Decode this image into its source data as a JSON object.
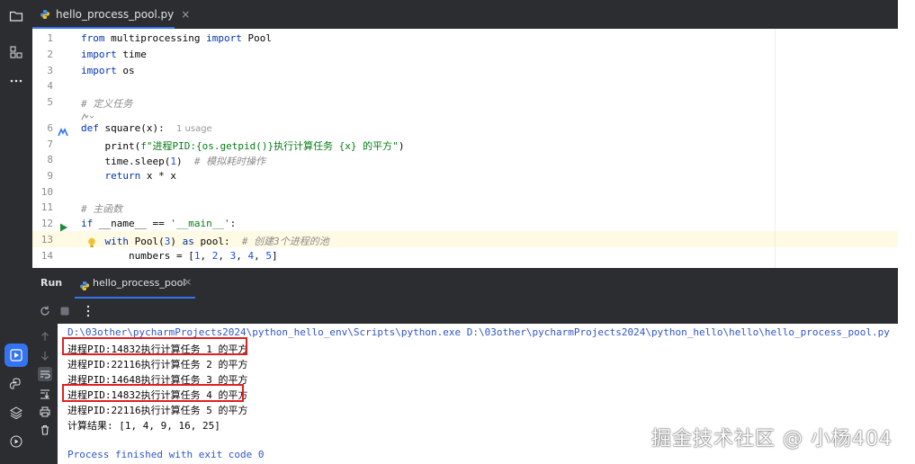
{
  "sidebar": {
    "icons": [
      "folder-icon",
      "structure-icon",
      "more-icon",
      "run-icon",
      "python-console-icon",
      "layers-icon",
      "services-icon"
    ]
  },
  "editor_tab": {
    "label": "hello_process_pool.py",
    "close": "×"
  },
  "editor": {
    "lines": [
      {
        "num": "1"
      },
      {
        "num": "2"
      },
      {
        "num": "3"
      },
      {
        "num": "4"
      },
      {
        "num": "5"
      },
      {
        "num": "6"
      },
      {
        "num": "7"
      },
      {
        "num": "8"
      },
      {
        "num": "9"
      },
      {
        "num": "10"
      },
      {
        "num": "11"
      },
      {
        "num": "12"
      },
      {
        "num": "13"
      },
      {
        "num": "14"
      }
    ],
    "code": {
      "l1_kw1": "from",
      "l1_mod": " multiprocessing ",
      "l1_kw2": "import",
      "l1_name": " Pool",
      "l2_kw": "import",
      "l2_name": " time",
      "l3_kw": "import",
      "l3_name": " os",
      "l5_comment": "# 定义任务",
      "l6_kw": "def",
      "l6_sig": " square(x):",
      "l6_hint": "1 usage",
      "l7_a": "    print(",
      "l7_str": "f\"进程PID:{os.getpid()}执行计算任务 {x} 的平方\"",
      "l7_b": ")",
      "l8_a": "    time.sleep(",
      "l8_num": "1",
      "l8_b": ")  ",
      "l8_comment": "# 模拟耗时操作",
      "l9_kw": "    return",
      "l9_rest": " x * x",
      "l11_comment": "# 主函数",
      "l12_kw": "if",
      "l12_a": " __name__ == ",
      "l12_str": "'__main__'",
      "l12_b": ":",
      "l13_kw1": "    with",
      "l13_a": " Pool(",
      "l13_num": "3",
      "l13_b": ") ",
      "l13_kw2": "as",
      "l13_c": " pool:  ",
      "l13_comment": "# 创建3个进程的池",
      "l14_a": "        numbers = [",
      "l14_n1": "1",
      "l14_s1": ", ",
      "l14_n2": "2",
      "l14_s2": ", ",
      "l14_n3": "3",
      "l14_s3": ", ",
      "l14_n4": "4",
      "l14_s4": ", ",
      "l14_n5": "5",
      "l14_b": "]"
    }
  },
  "run_panel": {
    "title": "Run",
    "tab_label": "hello_process_pool",
    "tab_close": "×",
    "output": [
      "D:\\03other\\pycharmProjects2024\\python_hello_env\\Scripts\\python.exe D:\\03other\\pycharmProjects2024\\python_hello\\hello\\hello_process_pool.py",
      "进程PID:14832执行计算任务 1 的平方",
      "进程PID:22116执行计算任务 2 的平方",
      "进程PID:14648执行计算任务 3 的平方",
      "进程PID:14832执行计算任务 4 的平方",
      "进程PID:22116执行计算任务 5 的平方",
      "计算结果: [1, 4, 9, 16, 25]",
      "",
      "Process finished with exit code 0"
    ]
  },
  "watermark": "掘金技术社区 @ 小杨404",
  "colors": {
    "accent": "#3574f0",
    "highlight_box": "#e02020",
    "keyword": "#0033b3",
    "string": "#067d17",
    "comment": "#8c8c8c"
  }
}
